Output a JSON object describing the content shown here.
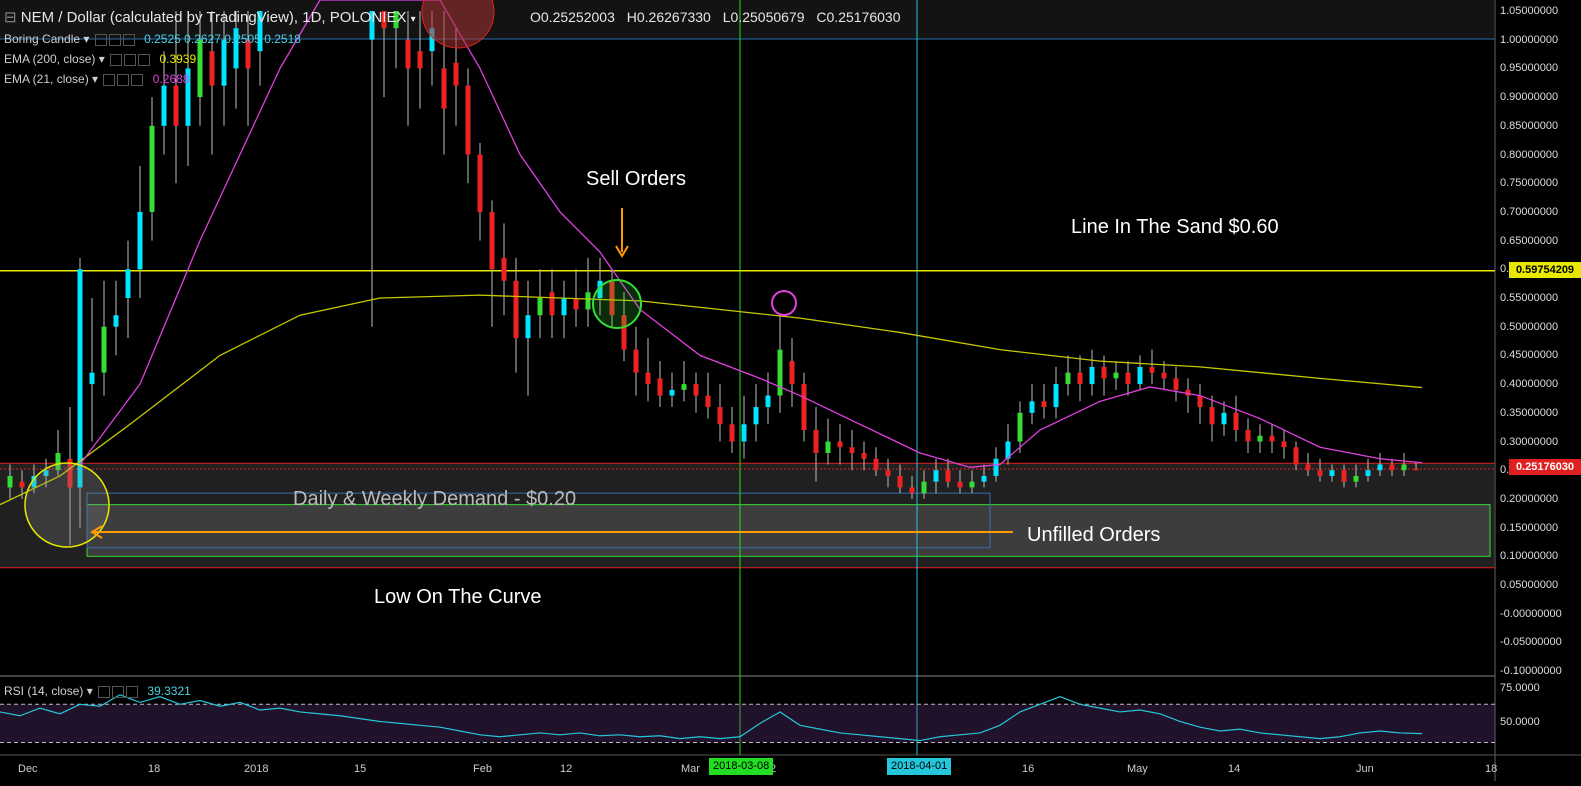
{
  "header": {
    "title": "NEM / Dollar (calculated by TradingView), 1D, POLONIEX",
    "ohlc": {
      "o_label": "O",
      "o": "0.25252003",
      "h_label": "H",
      "h": "0.26267330",
      "l_label": "L",
      "l": "0.25050679",
      "c_label": "C",
      "c": "0.25176030"
    }
  },
  "indicators": [
    {
      "label": "Boring Candle",
      "values": "0.2525  0.2627  0.2505  0.2518",
      "color": "#4dd0e1"
    },
    {
      "label": "EMA (200, close)",
      "values": "0.3939",
      "color": "#e8e800"
    },
    {
      "label": "EMA (21, close)",
      "values": "0.2688",
      "color": "#e040e0"
    }
  ],
  "rsi": {
    "label": "RSI (14, close)",
    "value": "39.3321",
    "ticks": [
      "75.0000",
      "50.0000"
    ]
  },
  "annotations": {
    "sell_orders": "Sell Orders",
    "line_in_sand": "Line In The Sand $0.60",
    "demand": "Daily & Weekly Demand - $0.20",
    "unfilled": "Unfilled Orders",
    "low_curve": "Low On The Curve"
  },
  "price_labels": {
    "line": "0.59754209",
    "last": "0.25176030"
  },
  "x_axis": {
    "ticks": [
      "Dec",
      "18",
      "2018",
      "15",
      "Feb",
      "12",
      "Mar",
      "2",
      "16",
      "May",
      "14",
      "Jun",
      "18"
    ],
    "marker1": "2018-03-08",
    "marker2": "2018-04-01"
  },
  "colors": {
    "up": "#00e5ff",
    "up_alt": "#33dd33",
    "down": "#ee2222",
    "ema200": "#c8c800",
    "ema21": "#e040e0",
    "hline": "#e8e800",
    "rsi": "#26c6da"
  },
  "chart_data": {
    "type": "candlestick",
    "title": "NEM / Dollar (calculated by TradingView), 1D, POLONIEX",
    "ylim": [
      -0.1,
      1.05
    ],
    "y_ticks": [
      "1.05000000",
      "1.00000000",
      "0.95000000",
      "0.90000000",
      "0.85000000",
      "0.80000000",
      "0.75000000",
      "0.70000000",
      "0.65000000",
      "0.60000000",
      "0.55000000",
      "0.50000000",
      "0.45000000",
      "0.40000000",
      "0.35000000",
      "0.30000000",
      "0.25000000",
      "0.20000000",
      "0.15000000",
      "0.10000000",
      "0.05000000",
      "-0.00000000",
      "-0.05000000",
      "-0.10000000"
    ],
    "horizontal_lines": [
      0.5975,
      0.262
    ],
    "zones": [
      {
        "name": "Daily & Weekly Demand",
        "from": 0.1,
        "to": 0.19
      }
    ],
    "ema200": [
      [
        0,
        0.19
      ],
      [
        60,
        0.24
      ],
      [
        130,
        0.33
      ],
      [
        220,
        0.45
      ],
      [
        300,
        0.52
      ],
      [
        380,
        0.55
      ],
      [
        480,
        0.555
      ],
      [
        560,
        0.55
      ],
      [
        640,
        0.545
      ],
      [
        720,
        0.53
      ],
      [
        800,
        0.515
      ],
      [
        900,
        0.49
      ],
      [
        1000,
        0.46
      ],
      [
        1100,
        0.44
      ],
      [
        1200,
        0.43
      ],
      [
        1320,
        0.41
      ],
      [
        1422,
        0.394
      ]
    ],
    "ema21": [
      [
        80,
        0.26
      ],
      [
        140,
        0.4
      ],
      [
        200,
        0.65
      ],
      [
        240,
        0.8
      ],
      [
        280,
        0.95
      ],
      [
        320,
        1.07
      ],
      [
        440,
        1.07
      ],
      [
        480,
        0.95
      ],
      [
        520,
        0.8
      ],
      [
        560,
        0.7
      ],
      [
        600,
        0.63
      ],
      [
        640,
        0.53
      ],
      [
        700,
        0.45
      ],
      [
        760,
        0.41
      ],
      [
        800,
        0.38
      ],
      [
        860,
        0.33
      ],
      [
        920,
        0.28
      ],
      [
        970,
        0.255
      ],
      [
        1000,
        0.26
      ],
      [
        1040,
        0.32
      ],
      [
        1100,
        0.37
      ],
      [
        1150,
        0.395
      ],
      [
        1200,
        0.38
      ],
      [
        1260,
        0.34
      ],
      [
        1320,
        0.29
      ],
      [
        1380,
        0.27
      ],
      [
        1422,
        0.263
      ]
    ],
    "candles": [
      [
        10,
        0.22,
        0.24,
        0.2,
        0.26
      ],
      [
        22,
        0.23,
        0.22,
        0.2,
        0.25
      ],
      [
        34,
        0.22,
        0.24,
        0.21,
        0.26
      ],
      [
        46,
        0.24,
        0.25,
        0.22,
        0.27
      ],
      [
        58,
        0.25,
        0.28,
        0.24,
        0.32
      ],
      [
        70,
        0.27,
        0.22,
        0.12,
        0.36
      ],
      [
        80,
        0.22,
        0.6,
        0.15,
        0.62
      ],
      [
        92,
        0.4,
        0.42,
        0.3,
        0.55
      ],
      [
        104,
        0.42,
        0.5,
        0.38,
        0.58
      ],
      [
        116,
        0.5,
        0.52,
        0.45,
        0.58
      ],
      [
        128,
        0.55,
        0.6,
        0.48,
        0.65
      ],
      [
        140,
        0.6,
        0.7,
        0.55,
        0.78
      ],
      [
        152,
        0.7,
        0.85,
        0.65,
        0.9
      ],
      [
        164,
        0.85,
        0.92,
        0.8,
        0.98
      ],
      [
        176,
        0.92,
        0.85,
        0.75,
        1.05
      ],
      [
        188,
        0.85,
        0.95,
        0.78,
        1.05
      ],
      [
        200,
        0.9,
        1.0,
        0.85,
        1.05
      ],
      [
        212,
        0.98,
        0.92,
        0.8,
        1.05
      ],
      [
        224,
        0.92,
        1.0,
        0.85,
        1.05
      ],
      [
        236,
        0.95,
        1.02,
        0.88,
        1.05
      ],
      [
        248,
        1.0,
        0.95,
        0.85,
        1.05
      ],
      [
        260,
        0.98,
        1.05,
        0.92,
        1.05
      ],
      [
        372,
        1.0,
        1.05,
        0.5,
        1.05
      ],
      [
        384,
        1.05,
        1.02,
        0.9,
        1.05
      ],
      [
        396,
        1.02,
        1.05,
        0.95,
        1.05
      ],
      [
        408,
        1.0,
        0.95,
        0.85,
        1.05
      ],
      [
        420,
        0.98,
        0.95,
        0.88,
        1.05
      ],
      [
        432,
        0.98,
        1.02,
        0.92,
        1.05
      ],
      [
        444,
        0.95,
        0.88,
        0.8,
        1.05
      ],
      [
        456,
        0.96,
        0.92,
        0.85,
        1.02
      ],
      [
        468,
        0.92,
        0.8,
        0.75,
        0.95
      ],
      [
        480,
        0.8,
        0.7,
        0.65,
        0.82
      ],
      [
        492,
        0.7,
        0.6,
        0.5,
        0.72
      ],
      [
        504,
        0.62,
        0.58,
        0.52,
        0.68
      ],
      [
        516,
        0.58,
        0.48,
        0.42,
        0.62
      ],
      [
        528,
        0.48,
        0.52,
        0.38,
        0.58
      ],
      [
        540,
        0.52,
        0.55,
        0.48,
        0.6
      ],
      [
        552,
        0.56,
        0.52,
        0.48,
        0.6
      ],
      [
        564,
        0.52,
        0.55,
        0.48,
        0.58
      ],
      [
        576,
        0.55,
        0.53,
        0.5,
        0.6
      ],
      [
        588,
        0.53,
        0.56,
        0.5,
        0.62
      ],
      [
        600,
        0.55,
        0.58,
        0.52,
        0.62
      ],
      [
        612,
        0.58,
        0.52,
        0.5,
        0.6
      ],
      [
        624,
        0.52,
        0.46,
        0.44,
        0.56
      ],
      [
        636,
        0.46,
        0.42,
        0.38,
        0.5
      ],
      [
        648,
        0.42,
        0.4,
        0.37,
        0.48
      ],
      [
        660,
        0.41,
        0.38,
        0.36,
        0.44
      ],
      [
        672,
        0.38,
        0.39,
        0.36,
        0.42
      ],
      [
        684,
        0.39,
        0.4,
        0.37,
        0.44
      ],
      [
        696,
        0.4,
        0.38,
        0.35,
        0.42
      ],
      [
        708,
        0.38,
        0.36,
        0.34,
        0.42
      ],
      [
        720,
        0.36,
        0.33,
        0.3,
        0.4
      ],
      [
        732,
        0.33,
        0.3,
        0.28,
        0.36
      ],
      [
        744,
        0.3,
        0.33,
        0.27,
        0.38
      ],
      [
        756,
        0.33,
        0.36,
        0.3,
        0.4
      ],
      [
        768,
        0.36,
        0.38,
        0.33,
        0.42
      ],
      [
        780,
        0.38,
        0.46,
        0.35,
        0.52
      ],
      [
        792,
        0.44,
        0.4,
        0.36,
        0.48
      ],
      [
        804,
        0.4,
        0.32,
        0.3,
        0.42
      ],
      [
        816,
        0.32,
        0.28,
        0.23,
        0.36
      ],
      [
        828,
        0.28,
        0.3,
        0.26,
        0.34
      ],
      [
        840,
        0.3,
        0.29,
        0.26,
        0.33
      ],
      [
        852,
        0.29,
        0.28,
        0.25,
        0.32
      ],
      [
        864,
        0.28,
        0.27,
        0.25,
        0.3
      ],
      [
        876,
        0.27,
        0.25,
        0.24,
        0.29
      ],
      [
        888,
        0.25,
        0.24,
        0.22,
        0.27
      ],
      [
        900,
        0.24,
        0.22,
        0.21,
        0.26
      ],
      [
        912,
        0.22,
        0.21,
        0.2,
        0.24
      ],
      [
        924,
        0.21,
        0.23,
        0.2,
        0.25
      ],
      [
        936,
        0.23,
        0.25,
        0.21,
        0.27
      ],
      [
        948,
        0.25,
        0.23,
        0.22,
        0.27
      ],
      [
        960,
        0.23,
        0.22,
        0.21,
        0.25
      ],
      [
        972,
        0.22,
        0.23,
        0.21,
        0.25
      ],
      [
        984,
        0.23,
        0.24,
        0.22,
        0.26
      ],
      [
        996,
        0.24,
        0.27,
        0.23,
        0.29
      ],
      [
        1008,
        0.27,
        0.3,
        0.26,
        0.33
      ],
      [
        1020,
        0.3,
        0.35,
        0.28,
        0.37
      ],
      [
        1032,
        0.35,
        0.37,
        0.33,
        0.4
      ],
      [
        1044,
        0.37,
        0.36,
        0.34,
        0.4
      ],
      [
        1056,
        0.36,
        0.4,
        0.34,
        0.43
      ],
      [
        1068,
        0.4,
        0.42,
        0.38,
        0.45
      ],
      [
        1080,
        0.42,
        0.4,
        0.37,
        0.45
      ],
      [
        1092,
        0.4,
        0.43,
        0.38,
        0.46
      ],
      [
        1104,
        0.43,
        0.41,
        0.38,
        0.45
      ],
      [
        1116,
        0.41,
        0.42,
        0.39,
        0.44
      ],
      [
        1128,
        0.42,
        0.4,
        0.38,
        0.44
      ],
      [
        1140,
        0.4,
        0.43,
        0.39,
        0.45
      ],
      [
        1152,
        0.43,
        0.42,
        0.4,
        0.46
      ],
      [
        1164,
        0.42,
        0.41,
        0.39,
        0.44
      ],
      [
        1176,
        0.41,
        0.39,
        0.37,
        0.43
      ],
      [
        1188,
        0.39,
        0.38,
        0.35,
        0.41
      ],
      [
        1200,
        0.38,
        0.36,
        0.33,
        0.4
      ],
      [
        1212,
        0.36,
        0.33,
        0.3,
        0.38
      ],
      [
        1224,
        0.33,
        0.35,
        0.31,
        0.37
      ],
      [
        1236,
        0.35,
        0.32,
        0.3,
        0.38
      ],
      [
        1248,
        0.32,
        0.3,
        0.28,
        0.34
      ],
      [
        1260,
        0.3,
        0.31,
        0.28,
        0.33
      ],
      [
        1272,
        0.31,
        0.3,
        0.28,
        0.33
      ],
      [
        1284,
        0.3,
        0.29,
        0.27,
        0.32
      ],
      [
        1296,
        0.29,
        0.26,
        0.25,
        0.3
      ],
      [
        1308,
        0.26,
        0.25,
        0.24,
        0.28
      ],
      [
        1320,
        0.25,
        0.24,
        0.23,
        0.27
      ],
      [
        1332,
        0.24,
        0.25,
        0.23,
        0.26
      ],
      [
        1344,
        0.25,
        0.23,
        0.22,
        0.26
      ],
      [
        1356,
        0.23,
        0.24,
        0.22,
        0.26
      ],
      [
        1368,
        0.24,
        0.25,
        0.23,
        0.27
      ],
      [
        1380,
        0.25,
        0.26,
        0.24,
        0.28
      ],
      [
        1392,
        0.26,
        0.25,
        0.24,
        0.27
      ],
      [
        1404,
        0.25,
        0.26,
        0.24,
        0.28
      ],
      [
        1416,
        0.2525,
        0.2518,
        0.2505,
        0.2627
      ]
    ],
    "rsi_series": [
      [
        0,
        62
      ],
      [
        20,
        58
      ],
      [
        40,
        66
      ],
      [
        60,
        60
      ],
      [
        80,
        70
      ],
      [
        100,
        68
      ],
      [
        120,
        80
      ],
      [
        140,
        72
      ],
      [
        160,
        78
      ],
      [
        180,
        70
      ],
      [
        200,
        74
      ],
      [
        220,
        68
      ],
      [
        240,
        72
      ],
      [
        260,
        64
      ],
      [
        280,
        66
      ],
      [
        300,
        62
      ],
      [
        320,
        60
      ],
      [
        340,
        58
      ],
      [
        360,
        55
      ],
      [
        380,
        52
      ],
      [
        400,
        50
      ],
      [
        420,
        48
      ],
      [
        440,
        46
      ],
      [
        460,
        42
      ],
      [
        480,
        38
      ],
      [
        500,
        36
      ],
      [
        520,
        38
      ],
      [
        540,
        40
      ],
      [
        560,
        38
      ],
      [
        580,
        40
      ],
      [
        600,
        37
      ],
      [
        620,
        38
      ],
      [
        640,
        36
      ],
      [
        660,
        37
      ],
      [
        680,
        34
      ],
      [
        700,
        36
      ],
      [
        720,
        34
      ],
      [
        740,
        36
      ],
      [
        760,
        50
      ],
      [
        780,
        62
      ],
      [
        800,
        48
      ],
      [
        820,
        44
      ],
      [
        840,
        40
      ],
      [
        860,
        38
      ],
      [
        880,
        36
      ],
      [
        900,
        34
      ],
      [
        920,
        32
      ],
      [
        940,
        36
      ],
      [
        960,
        38
      ],
      [
        980,
        40
      ],
      [
        1000,
        48
      ],
      [
        1020,
        62
      ],
      [
        1040,
        70
      ],
      [
        1060,
        78
      ],
      [
        1080,
        70
      ],
      [
        1100,
        66
      ],
      [
        1120,
        62
      ],
      [
        1140,
        64
      ],
      [
        1160,
        60
      ],
      [
        1180,
        52
      ],
      [
        1200,
        46
      ],
      [
        1220,
        42
      ],
      [
        1240,
        44
      ],
      [
        1260,
        40
      ],
      [
        1280,
        38
      ],
      [
        1300,
        36
      ],
      [
        1320,
        34
      ],
      [
        1340,
        36
      ],
      [
        1360,
        40
      ],
      [
        1380,
        42
      ],
      [
        1400,
        40
      ],
      [
        1422,
        39.3
      ]
    ],
    "rsi_ylim": [
      20,
      85
    ]
  }
}
